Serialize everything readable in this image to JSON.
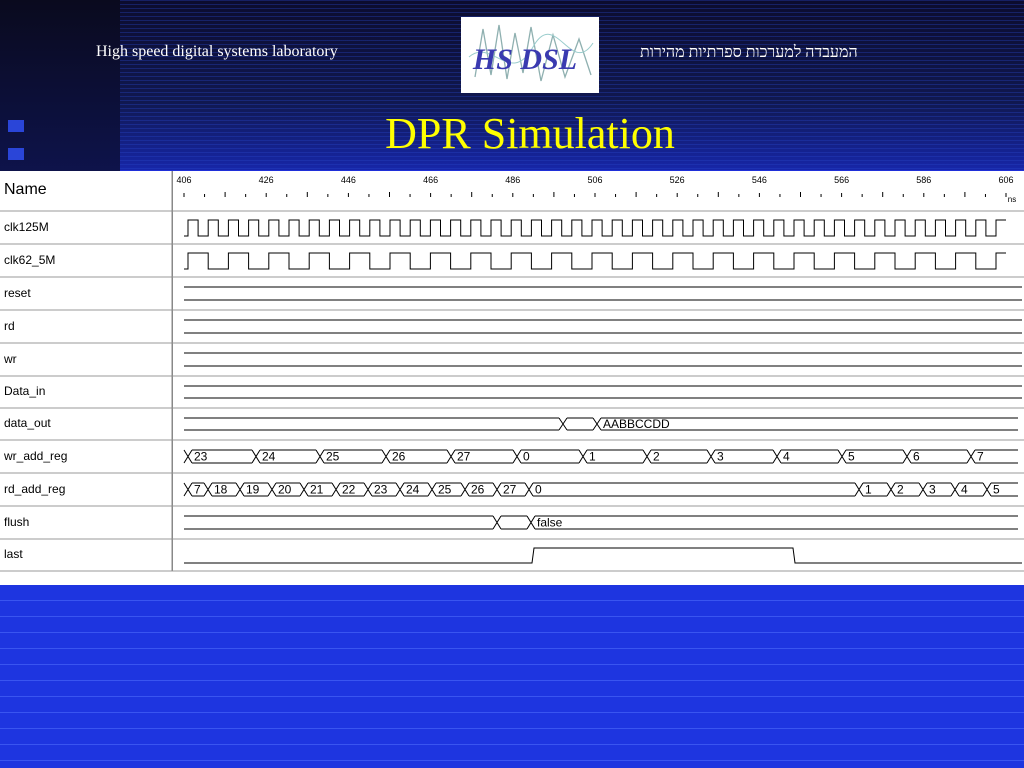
{
  "header": {
    "lab_name": "High speed digital systems laboratory",
    "lab_name_hebrew": "המעבדה למערכות ספרתיות מהירות",
    "logo_text": "HS DSL",
    "slide_title": "DPR Simulation"
  },
  "waveform": {
    "name_header": "Name",
    "time_unit": "ns",
    "time_ticks": [
      "406",
      "426",
      "446",
      "466",
      "486",
      "506",
      "526",
      "546",
      "566",
      "586",
      "606"
    ],
    "signals": [
      {
        "name": "clk125M",
        "kind": "clock"
      },
      {
        "name": "clk62_5M",
        "kind": "clock"
      },
      {
        "name": "reset",
        "kind": "low"
      },
      {
        "name": "rd",
        "kind": "low"
      },
      {
        "name": "wr",
        "kind": "low"
      },
      {
        "name": "Data_in",
        "kind": "bus"
      },
      {
        "name": "data_out",
        "kind": "bus",
        "values": [
          "AABBCCDD"
        ]
      },
      {
        "name": "wr_add_reg",
        "kind": "bus",
        "values": [
          "23",
          "24",
          "25",
          "26",
          "27",
          "0",
          "1",
          "2",
          "3",
          "4",
          "5",
          "6",
          "7"
        ]
      },
      {
        "name": "rd_add_reg",
        "kind": "bus",
        "values": [
          "7",
          "18",
          "19",
          "20",
          "21",
          "22",
          "23",
          "24",
          "25",
          "26",
          "27",
          "0",
          "1",
          "2",
          "3",
          "4",
          "5"
        ]
      },
      {
        "name": "flush",
        "kind": "bus",
        "values": [
          "false"
        ]
      },
      {
        "name": "last",
        "kind": "pulse"
      }
    ]
  }
}
